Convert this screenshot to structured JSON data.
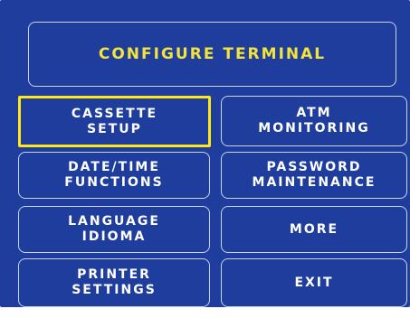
{
  "header": {
    "title": "CONFIGURE TERMINAL"
  },
  "menu": {
    "cassette_setup": {
      "line1": "CASSETTE",
      "line2": "SETUP",
      "selected": true
    },
    "atm_monitoring": {
      "line1": "ATM",
      "line2": "MONITORING"
    },
    "date_time_functions": {
      "line1": "DATE/TIME",
      "line2": "FUNCTIONS"
    },
    "password_maintenance": {
      "line1": "PASSWORD",
      "line2": "MAINTENANCE"
    },
    "language_idioma": {
      "line1": "LANGUAGE",
      "line2": "IDIOMA"
    },
    "more": {
      "label": "MORE"
    },
    "printer_settings": {
      "line1": "PRINTER",
      "line2": "SETTINGS"
    },
    "exit": {
      "label": "EXIT"
    }
  },
  "colors": {
    "background": "#1f3d9c",
    "title_text": "#f2e43a",
    "button_text": "#ffffff",
    "button_border": "#c9d4f0",
    "selection_border": "#ffe817"
  }
}
